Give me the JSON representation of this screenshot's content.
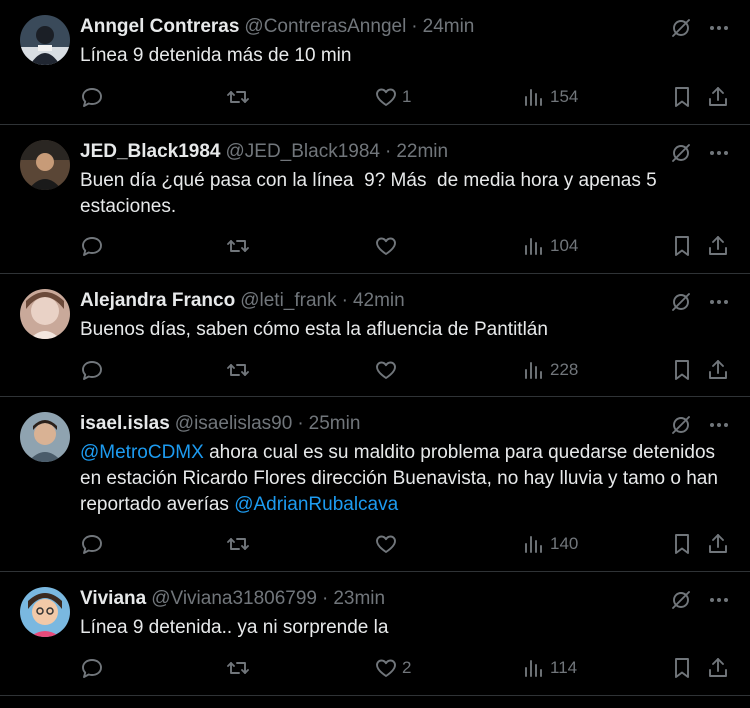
{
  "tweets": [
    {
      "name": "Anngel Contreras",
      "handle": "@ContrerasAnngel",
      "sep": "·",
      "time": "24min",
      "text": "Línea 9 detenida más de 10 min",
      "likes": "1",
      "views": "154",
      "avatar_bg": "#3a4a5a"
    },
    {
      "name": "JED_Black1984",
      "handle": "@JED_Black1984",
      "sep": "·",
      "time": "22min",
      "text": "Buen día ¿qué pasa con la línea  9? Más  de media hora y apenas 5 estaciones.",
      "likes": "",
      "views": "104",
      "avatar_bg": "#5a4636"
    },
    {
      "name": "Alejandra Franco",
      "handle": "@leti_frank",
      "sep": "·",
      "time": "42min",
      "text": "Buenos días, saben cómo esta la afluencia de Pantitlán",
      "likes": "",
      "views": "228",
      "avatar_bg": "#c9a99a"
    },
    {
      "name": "isael.islas",
      "handle": "@isaelislas90",
      "sep": "·",
      "time": "25min",
      "text_mention_1": "@MetroCDMX",
      "text_body": " ahora cual es su maldito problema para quedarse detenidos en estación Ricardo Flores dirección Buenavista, no hay lluvia y tamo o han reportado averías ",
      "text_mention_2": "@AdrianRubalcava",
      "likes": "",
      "views": "140",
      "avatar_bg": "#8fa3b0"
    },
    {
      "name": "Viviana",
      "handle": "@Viviana31806799",
      "sep": "·",
      "time": "23min",
      "text": "Línea 9 detenida.. ya ni sorprende la",
      "likes": "2",
      "views": "114",
      "avatar_bg": "#7ab8e0"
    }
  ],
  "icons": {
    "grok": "grok-icon",
    "more": "more-icon",
    "reply": "reply-icon",
    "retweet": "retweet-icon",
    "like": "like-icon",
    "views": "views-icon",
    "bookmark": "bookmark-icon",
    "share": "share-icon"
  },
  "colors": {
    "background": "#000000",
    "text": "#e7e9ea",
    "muted": "#71767b",
    "link": "#1d9bf0",
    "divider": "#2f3336"
  }
}
